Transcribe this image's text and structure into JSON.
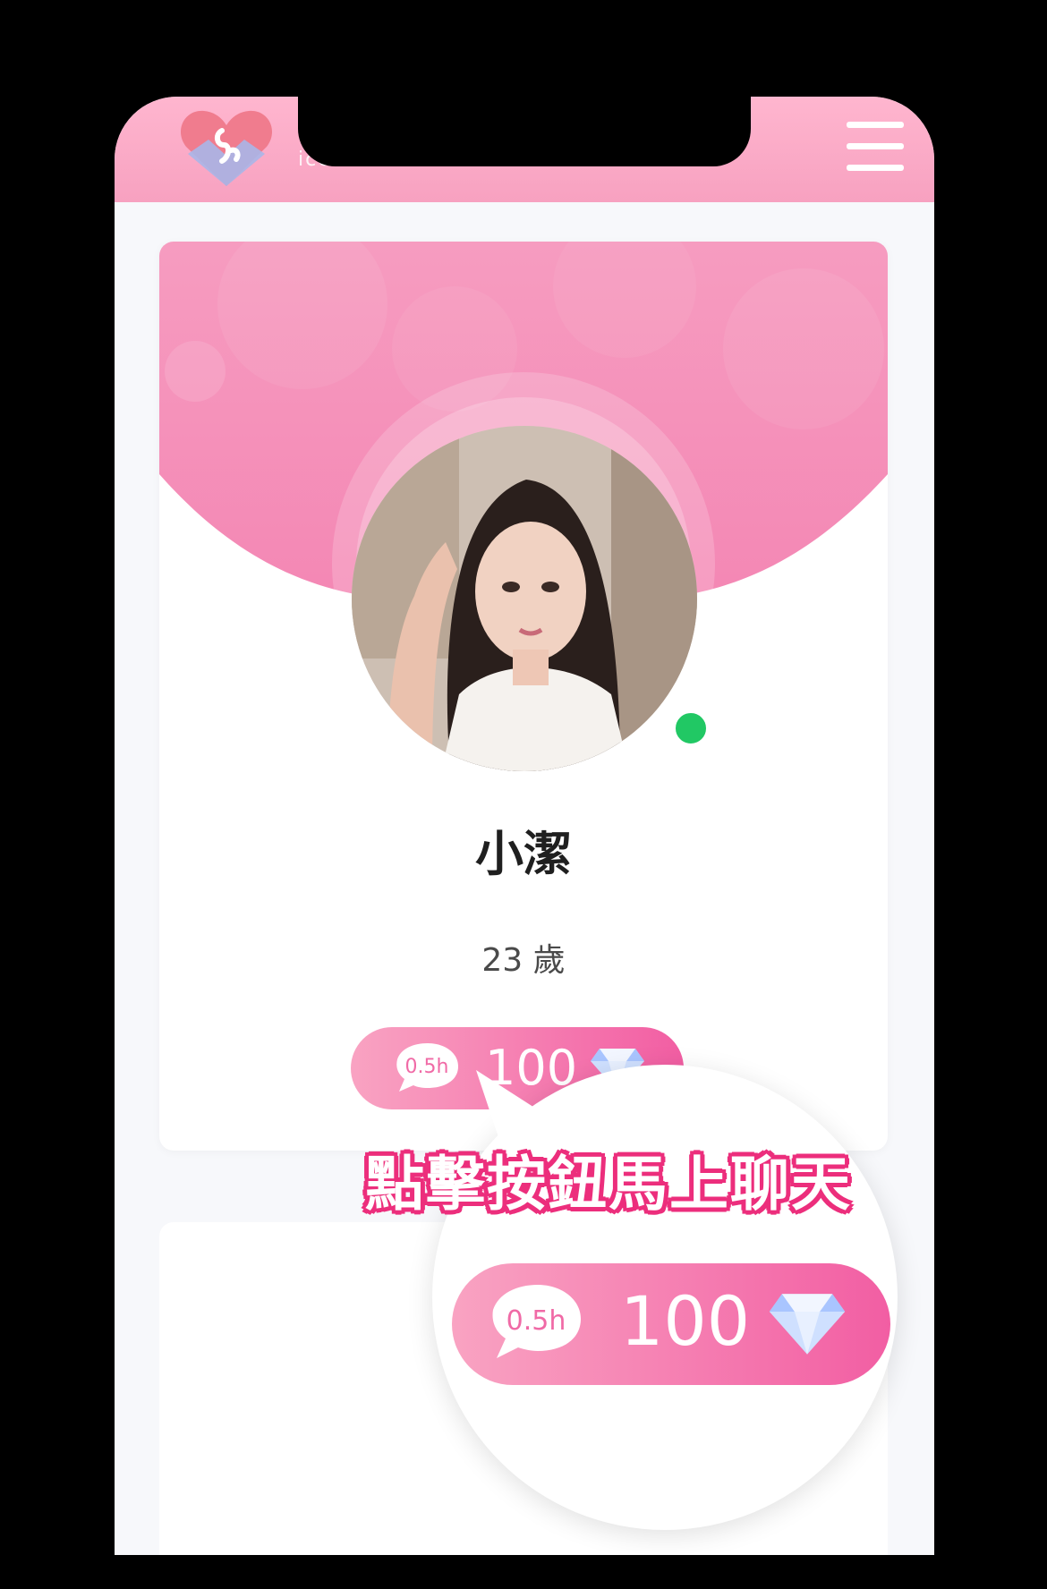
{
  "header": {
    "logo_text": "ice  Sweet",
    "menu_icon": "hamburger-menu-icon"
  },
  "profile": {
    "name": "小潔",
    "age": "23 歲",
    "status": "online"
  },
  "chat_button": {
    "duration": "0.5h",
    "price": "100",
    "currency_icon": "diamond-icon"
  },
  "magnified_button": {
    "duration": "0.5h",
    "price": "100",
    "currency_icon": "diamond-icon"
  },
  "callout": {
    "text": "點擊按鈕馬上聊天"
  },
  "colors": {
    "header_pink": "#f7a1c0",
    "banner_pink": "#f58ab5",
    "button_start": "#f9a3c2",
    "button_end": "#f25ea3",
    "online_green": "#21c864",
    "callout_stroke": "#ec2e7c"
  }
}
